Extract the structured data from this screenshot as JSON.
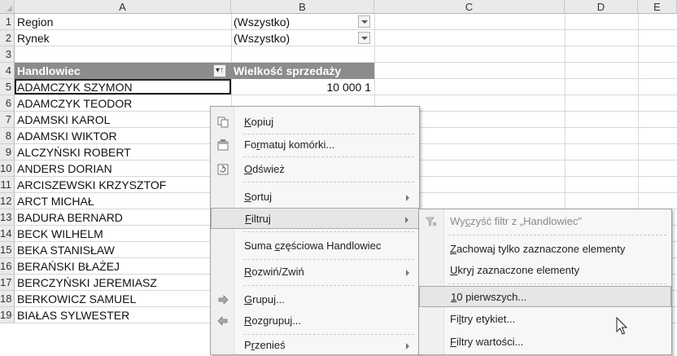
{
  "columns": [
    "A",
    "B",
    "C",
    "D",
    "E"
  ],
  "rows": [
    "1",
    "2",
    "3",
    "4",
    "5",
    "6",
    "7",
    "8",
    "9",
    "10",
    "11",
    "12",
    "13",
    "14",
    "15",
    "16",
    "17",
    "18",
    "19"
  ],
  "filters": [
    {
      "label": "Region",
      "value": "(Wszystko)"
    },
    {
      "label": "Rynek",
      "value": "(Wszystko)"
    }
  ],
  "pivot": {
    "row_header": "Handlowiec",
    "value_header": "Wielkość sprzedaży",
    "first_value_partial": "10 000 1"
  },
  "names": [
    "ADAMCZYK SZYMON",
    "ADAMCZYK TEODOR",
    "ADAMSKI KAROL",
    "ADAMSKI WIKTOR",
    "ALCZYŃSKI ROBERT",
    "ANDERS DORIAN",
    "ARCISZEWSKI KRZYSZTOF",
    "ARCT MICHAŁ",
    "BADURA BERNARD",
    "BECK WILHELM",
    "BEKA STANISŁAW",
    "BERAŃSKI BŁAŻEJ",
    "BERCZYŃSKI JEREMIASZ",
    "BERKOWICZ SAMUEL",
    "BIAŁAS SYLWESTER"
  ],
  "context_menu": {
    "items": [
      {
        "pre": "",
        "u": "K",
        "post": "opiuj",
        "icon": "copy-icon"
      },
      {
        "pre": "Fo",
        "u": "r",
        "post": "matuj komórki...",
        "icon": "format-cells-icon"
      },
      {
        "pre": "",
        "u": "O",
        "post": "dśwież",
        "icon": "refresh-icon"
      },
      {
        "pre": "",
        "u": "S",
        "post": "ortuj",
        "submenu": true
      },
      {
        "pre": "",
        "u": "F",
        "post": "iltruj",
        "submenu": true
      },
      {
        "pre": "Suma ",
        "u": "c",
        "post": "zęściowa Handlowiec"
      },
      {
        "pre": "",
        "u": "R",
        "post": "ozwiń/Zwiń",
        "submenu": true
      },
      {
        "pre": "",
        "u": "G",
        "post": "rupuj...",
        "icon": "group-icon"
      },
      {
        "pre": "",
        "u": "R",
        "post": "ozgrupuj...",
        "icon": "ungroup-icon"
      },
      {
        "pre": "P",
        "u": "r",
        "post": "zenieś",
        "submenu": true
      }
    ]
  },
  "filter_submenu": {
    "items": [
      {
        "pre": "Wy",
        "u": "c",
        "post": "zyść filtr z „Handlowiec\"",
        "disabled": true
      },
      {
        "pre": "",
        "u": "Z",
        "post": "achowaj tylko zaznaczone elementy"
      },
      {
        "pre": "",
        "u": "U",
        "post": "kryj zaznaczone elementy"
      },
      {
        "pre": "",
        "u": "1",
        "post": "0 pierwszych..."
      },
      {
        "pre": "Fi",
        "u": "l",
        "post": "try etykiet..."
      },
      {
        "pre": "",
        "u": "F",
        "post": "iltry wartości..."
      }
    ]
  }
}
